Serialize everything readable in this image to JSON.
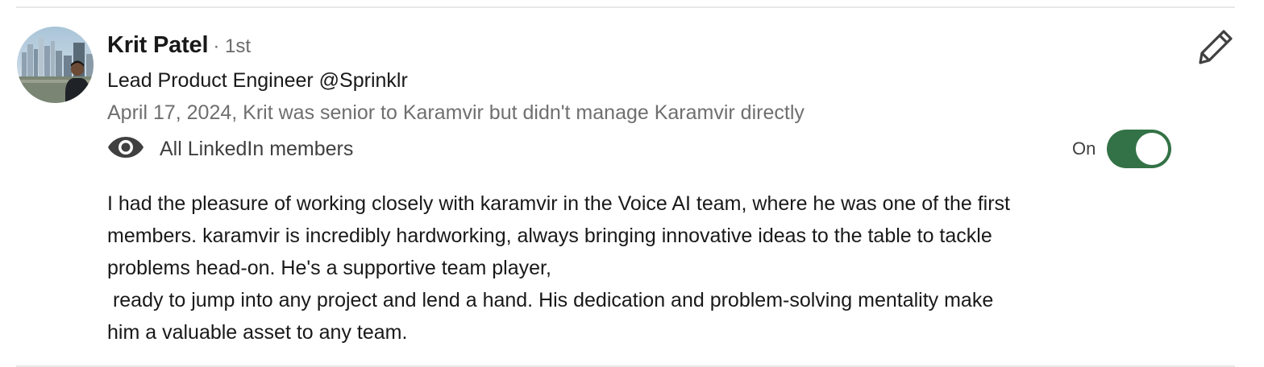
{
  "recommendation": {
    "name": "Krit Patel",
    "degree": "· 1st",
    "headline": "Lead Product Engineer @Sprinklr",
    "meta": "April 17, 2024, Krit was senior to Karamvir but didn't manage Karamvir directly",
    "visibility": {
      "icon": "eye-icon",
      "label": "All LinkedIn members"
    },
    "toggle": {
      "label": "On",
      "state": true,
      "color": "#337246"
    },
    "edit_icon": "pencil-icon",
    "body_lines": [
      "I had the pleasure of working closely with karamvir in the Voice AI team, where he was one of the first",
      "members. karamvir is incredibly hardworking, always bringing innovative ideas to the table to tackle",
      "problems head-on. He's a supportive team player,",
      " ready to jump into any project and lend a hand. His dedication and problem-solving mentality make",
      "him a valuable asset to any team."
    ]
  }
}
